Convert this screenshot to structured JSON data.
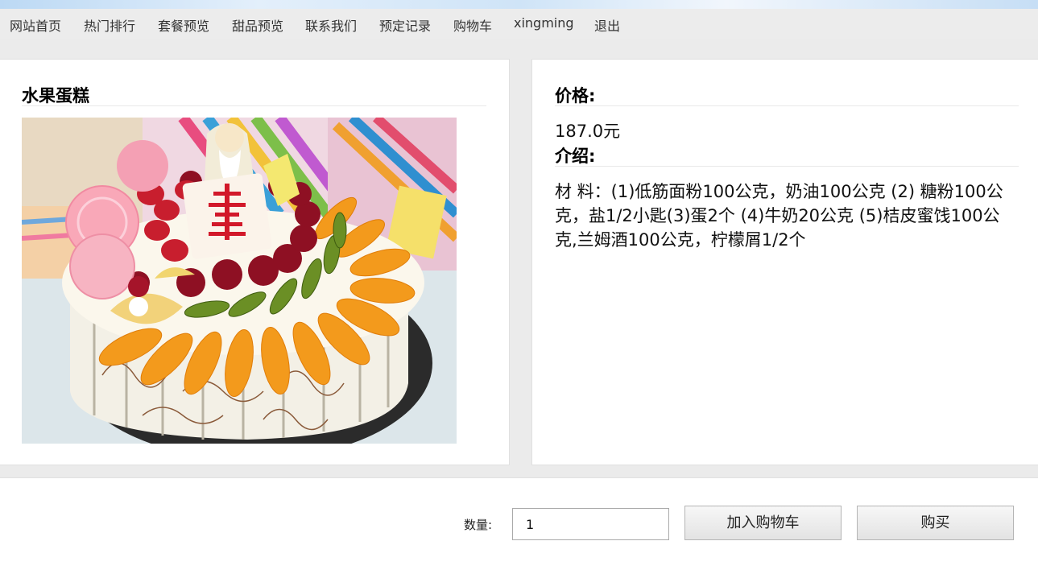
{
  "nav": {
    "items": [
      "网站首页",
      "热门排行",
      "套餐预览",
      "甜品预览",
      "联系我们",
      "预定记录",
      "购物车",
      "xingming",
      "退出"
    ]
  },
  "product": {
    "name": "水果蛋糕",
    "image_icon": "cake-photo",
    "price_heading": "价格:",
    "price": "187.0元",
    "intro_heading": "介绍:",
    "description": "材 料：(1)低筋面粉100公克，奶油100公克 (2) 糖粉100公克，盐1/2小匙(3)蛋2个 (4)牛奶20公克 (5)桔皮蜜饯100公克,兰姆酒100公克，柠檬屑1/2个"
  },
  "order": {
    "quantity_label": "数量:",
    "quantity_value": "1",
    "add_to_cart_label": "加入购物车",
    "buy_label": "购买"
  }
}
